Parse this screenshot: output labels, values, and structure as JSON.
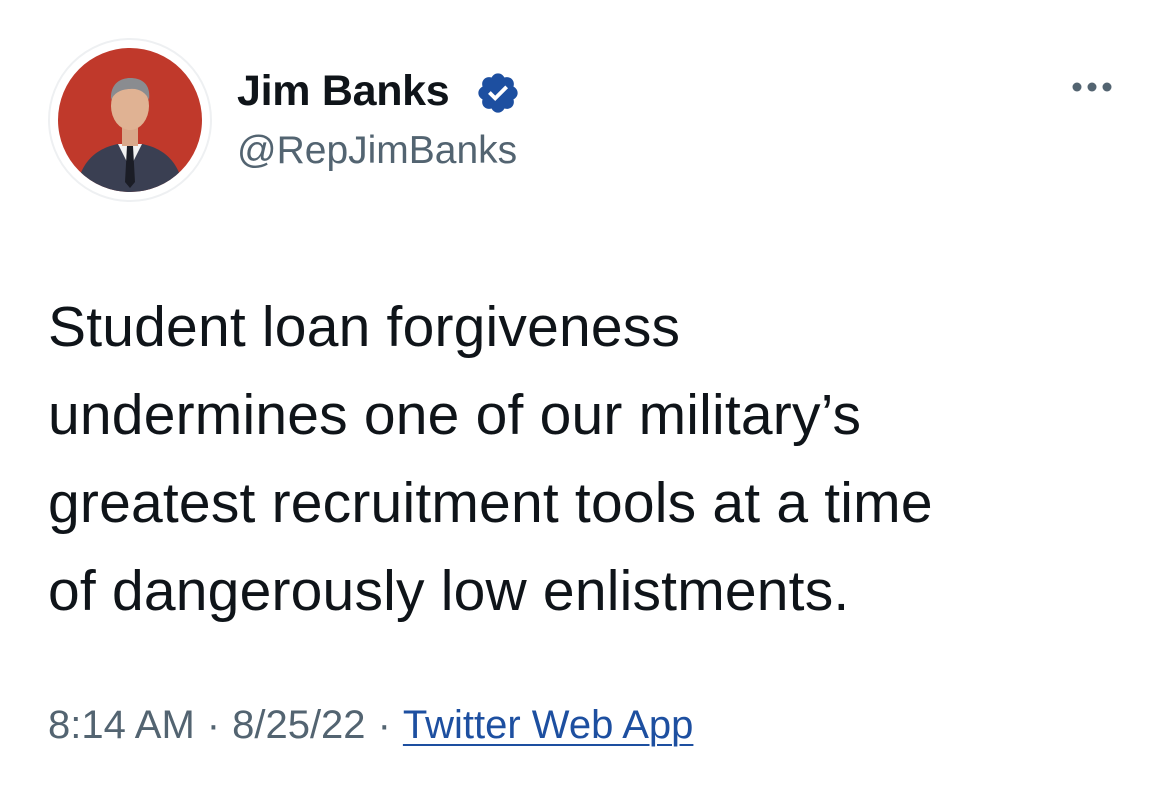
{
  "author": {
    "display_name": "Jim Banks",
    "handle": "@RepJimBanks",
    "verified": true,
    "avatar": "profile-photo"
  },
  "menu": {
    "icon": "more-horizontal-icon"
  },
  "tweet": {
    "text": "Student loan forgiveness\nundermines one of our military’s\ngreatest recruitment tools at a time\nof dangerously low enlistments."
  },
  "meta": {
    "time": "8:14 AM",
    "separator": "·",
    "date": "8/25/22",
    "source": "Twitter Web App"
  },
  "colors": {
    "text": "#0f1419",
    "secondary": "#536471",
    "link": "#1d4fa0",
    "verified_badge": "#1d4fa0",
    "avatar_background": "#c0392b"
  }
}
